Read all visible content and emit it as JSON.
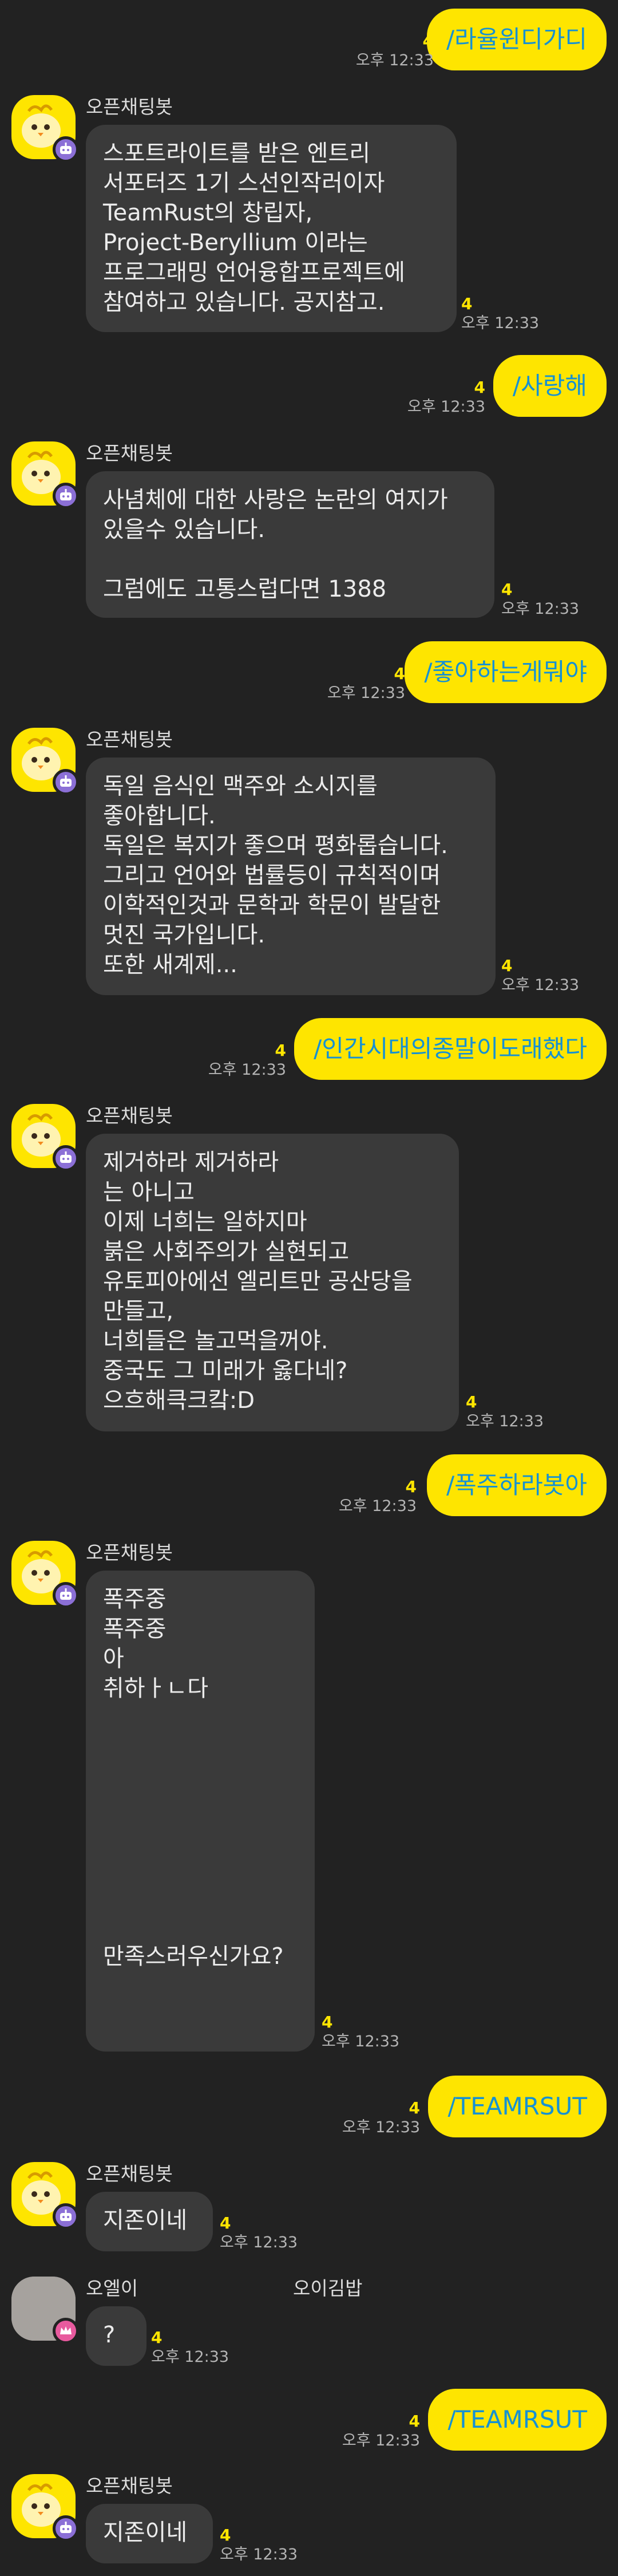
{
  "messages": [
    {
      "from": "me",
      "text": "/라율윈디가디",
      "unread": "4",
      "time": "오후 12:33"
    },
    {
      "from": "bot",
      "sender": "오픈채팅봇",
      "text": "스포트라이트를 받은 엔트리\n서포터즈 1기 스선인작러이자\nTeamRust의 창립자,\nProject-Beryllium 이라는\n프로그래밍 언어융합프로젝트에\n참여하고 있습니다. 공지참고.",
      "unread": "4",
      "time": "오후 12:33"
    },
    {
      "from": "me",
      "text": "/사랑해",
      "unread": "4",
      "time": "오후 12:33"
    },
    {
      "from": "bot",
      "sender": "오픈채팅봇",
      "text": "사념체에 대한 사랑은 논란의 여지가\n있을수 있습니다.\n\n그럼에도 고통스럽다면 1388",
      "unread": "4",
      "time": "오후 12:33"
    },
    {
      "from": "me",
      "text": "/좋아하는게뭐야",
      "unread": "4",
      "time": "오후 12:33"
    },
    {
      "from": "bot",
      "sender": "오픈채팅봇",
      "text": "독일 음식인 맥주와 소시지를\n좋아합니다.\n독일은 복지가 좋으며 평화롭습니다.\n그리고 언어와 법률등이 규칙적이며\n이학적인것과 문학과 학문이 발달한\n멋진 국가입니다.\n또한 새계제...",
      "unread": "4",
      "time": "오후 12:33"
    },
    {
      "from": "me",
      "text": "/인간시대의종말이도래했다",
      "unread": "4",
      "time": "오후 12:33"
    },
    {
      "from": "bot",
      "sender": "오픈채팅봇",
      "text": "제거하라 제거하라\n는 아니고\n이제 너희는 일하지마\n붉은 사회주의가 실현되고\n유토피아에선 엘리트만 공산당을\n만들고,\n너희들은 놀고먹을꺼야.\n중국도 그 미래가 옳다네?\n으흐해큭크캌:D",
      "unread": "4",
      "time": "오후 12:33"
    },
    {
      "from": "me",
      "text": "/폭주하라봇아",
      "unread": "4",
      "time": "오후 12:33"
    },
    {
      "from": "bot",
      "sender": "오픈채팅봇",
      "text": "폭주중\n폭주중\n아\n취하ㅏㄴ다\n\n\n\n\n\n\n\n\n만족스러우신가요?",
      "unread": "4",
      "time": "오후 12:33"
    },
    {
      "from": "me",
      "text": "/TEAMRSUT",
      "unread": "4",
      "time": "오후 12:33"
    },
    {
      "from": "bot",
      "sender": "오픈채팅봇",
      "text": "지존이네",
      "unread": "4",
      "time": "오후 12:33"
    },
    {
      "from": "user",
      "sender": "오엘이",
      "sender_extra": "오이김밥",
      "text": "?",
      "unread": "4",
      "time": "오후 12:33"
    },
    {
      "from": "me",
      "text": "/TEAMRSUT",
      "unread": "4",
      "time": "오후 12:33"
    },
    {
      "from": "bot",
      "sender": "오픈채팅봇",
      "text": "지존이네",
      "unread": "4",
      "time": "오후 12:33"
    }
  ],
  "colors": {
    "background": "#222222",
    "my_bubble": "#fee500",
    "my_text": "#1591d4",
    "bot_bubble": "#3a3a3a",
    "unread": "#fee500",
    "bot_badge": "#8b6fd6",
    "user_badge": "#e85a9e"
  },
  "icons": {
    "bot_avatar": "yellow-chick-avatar-icon",
    "bot_badge": "robot-icon",
    "user_avatar": "gray-avatar-icon",
    "user_badge": "crown-icon"
  }
}
